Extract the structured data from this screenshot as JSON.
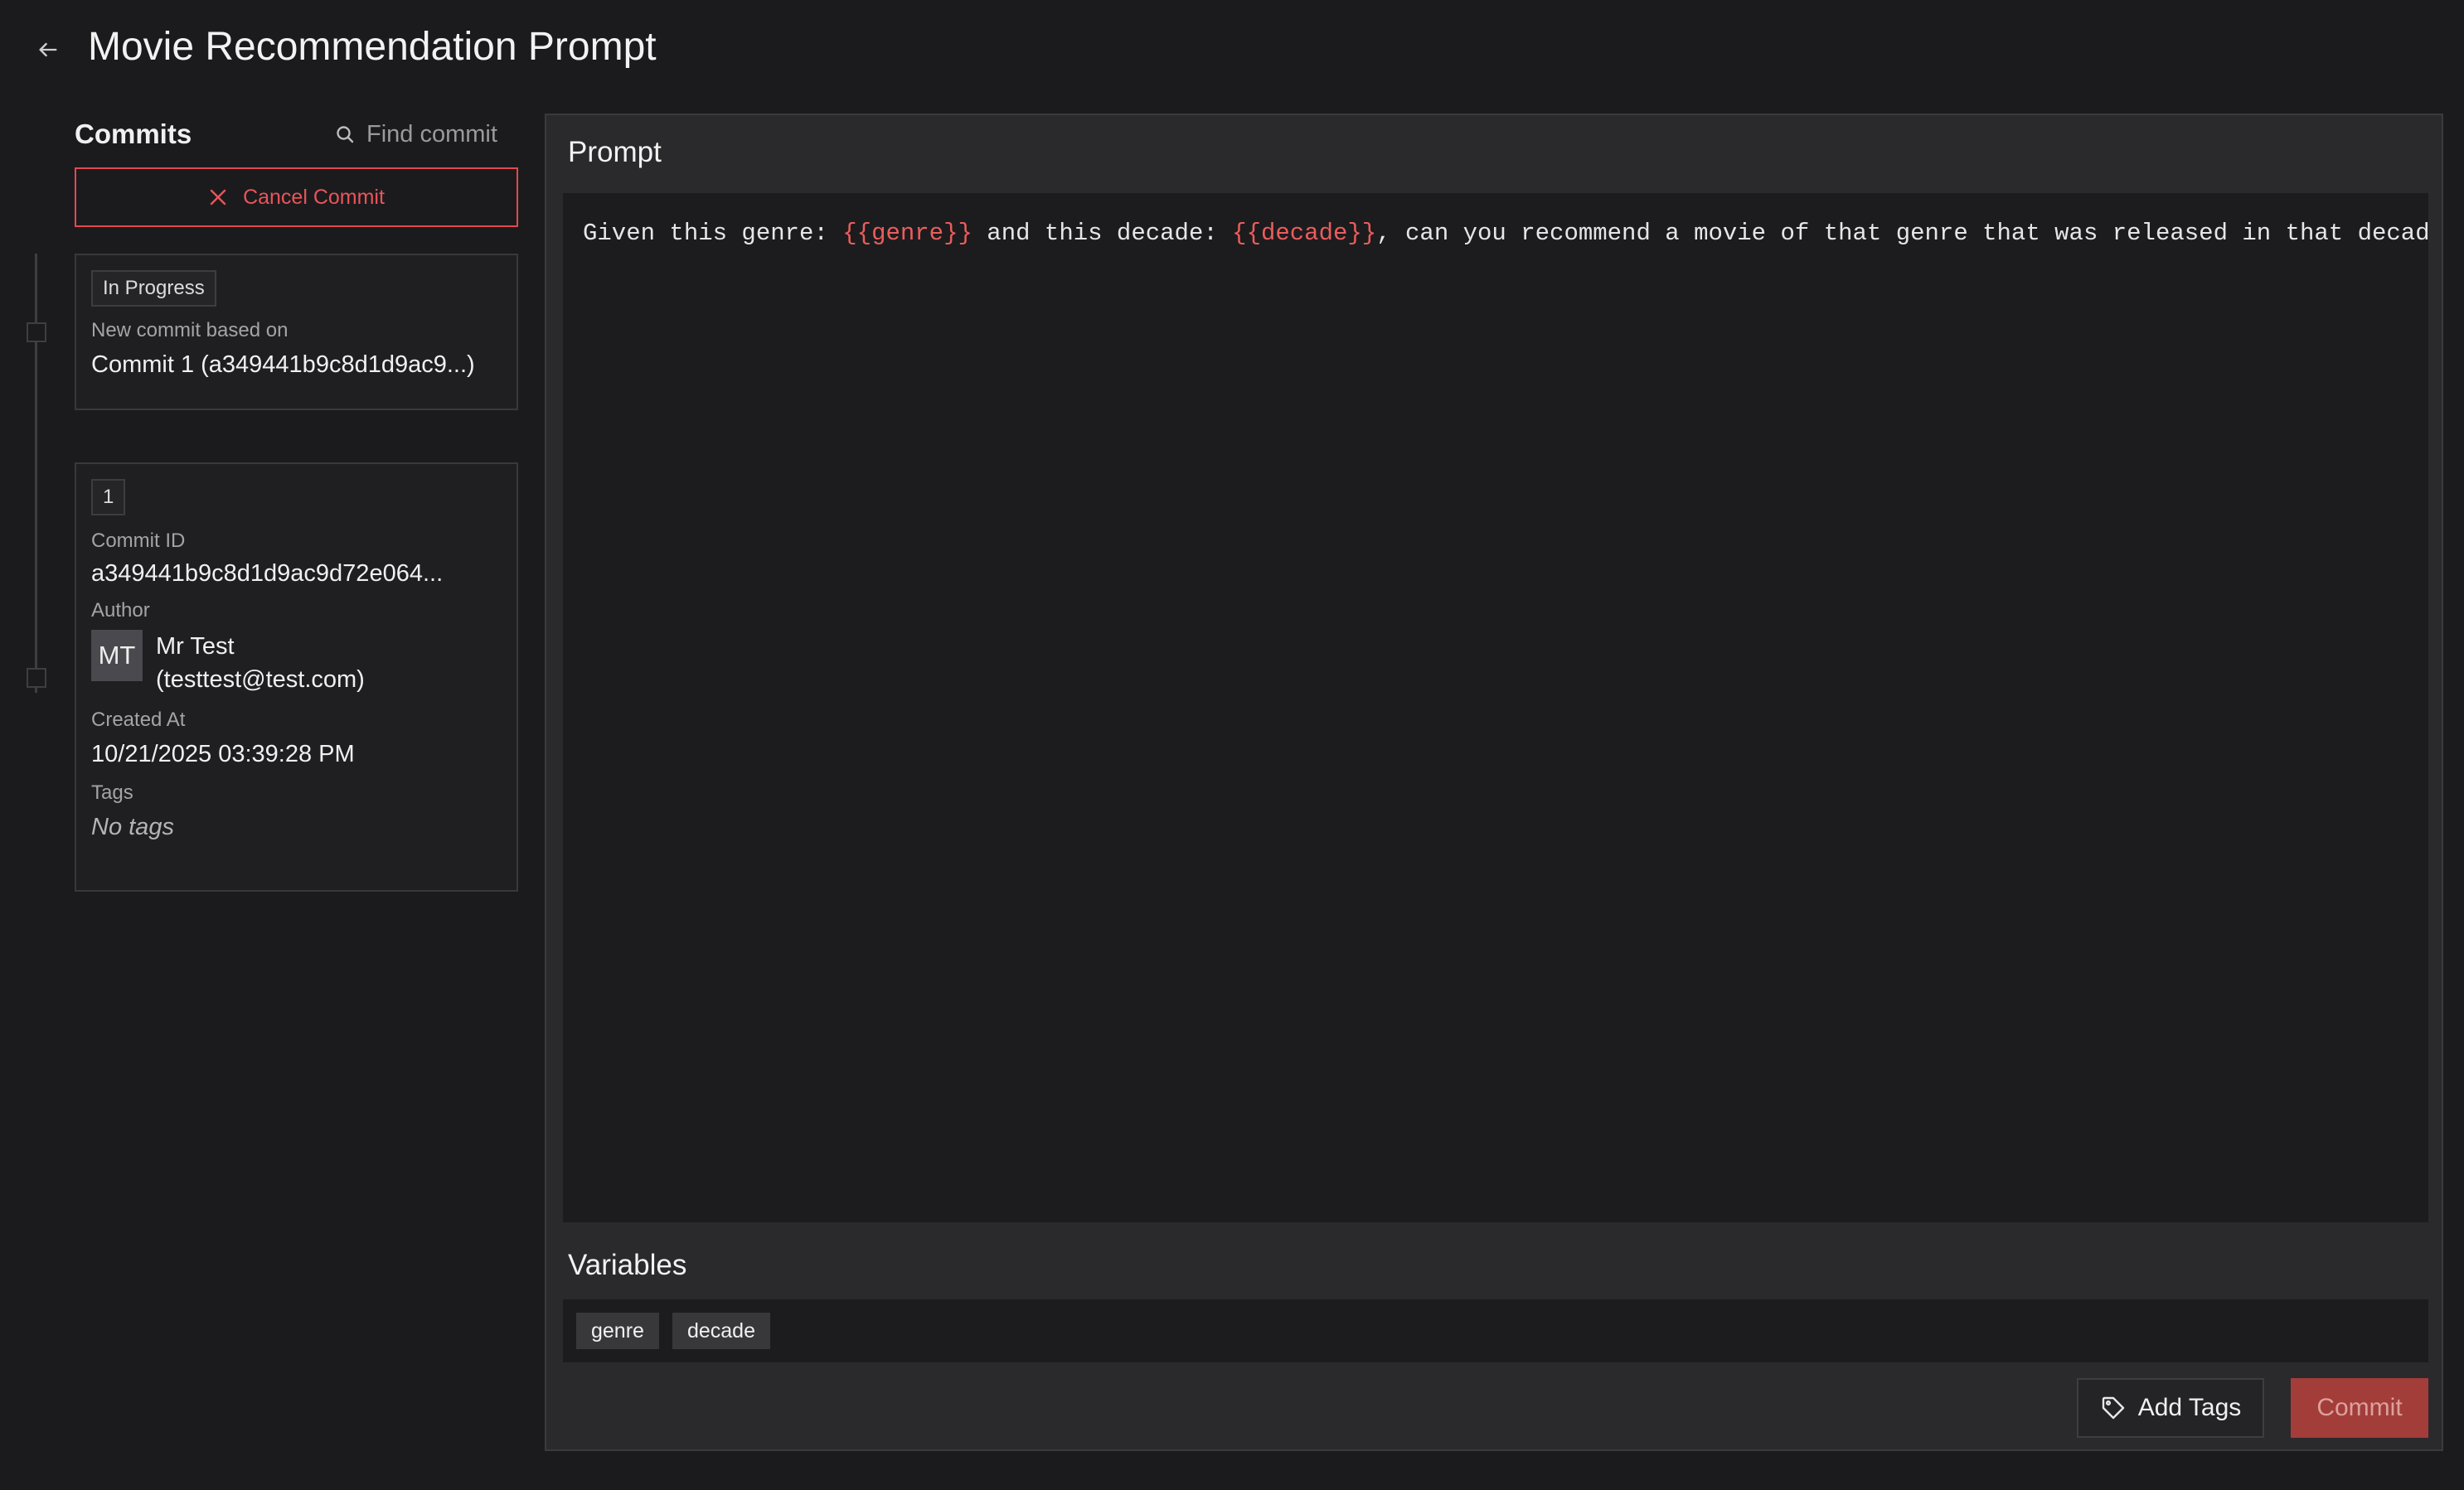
{
  "header": {
    "title": "Movie Recommendation Prompt"
  },
  "commits": {
    "heading": "Commits",
    "find_placeholder": "Find commit",
    "cancel_label": "Cancel Commit",
    "in_progress_card": {
      "badge": "In Progress",
      "based_on_label": "New commit based on",
      "based_on_value": "Commit 1 (a349441b9c8d1d9ac9...)"
    },
    "commit_card": {
      "badge": "1",
      "id_label": "Commit ID",
      "id_value": "a349441b9c8d1d9ac9d72e064...",
      "author_label": "Author",
      "avatar_initials": "MT",
      "author_name": "Mr Test",
      "author_email": "(testtest@test.com)",
      "created_label": "Created At",
      "created_value": "10/21/2025 03:39:28 PM",
      "tags_label": "Tags",
      "tags_value": "No tags"
    }
  },
  "prompt": {
    "heading": "Prompt",
    "segments": {
      "s1": "Given this genre: ",
      "v1": "{{genre}}",
      "s2": " and this decade: ",
      "v2": "{{decade}}",
      "s3": ", can you recommend a movie of that genre that was released in that decade?"
    }
  },
  "variables": {
    "heading": "Variables",
    "items": [
      "genre",
      "decade"
    ]
  },
  "actions": {
    "add_tags_label": "Add Tags",
    "commit_label": "Commit"
  },
  "colors": {
    "accent": "#e5484d",
    "variable": "#ea5d5d",
    "commit_button": "#a33d3a",
    "background": "#1b1b1d",
    "panel": "#2a2a2c"
  },
  "icons": {
    "back": "arrow-left-icon",
    "search": "search-icon",
    "cancel": "close-icon",
    "tag": "tag-icon"
  }
}
